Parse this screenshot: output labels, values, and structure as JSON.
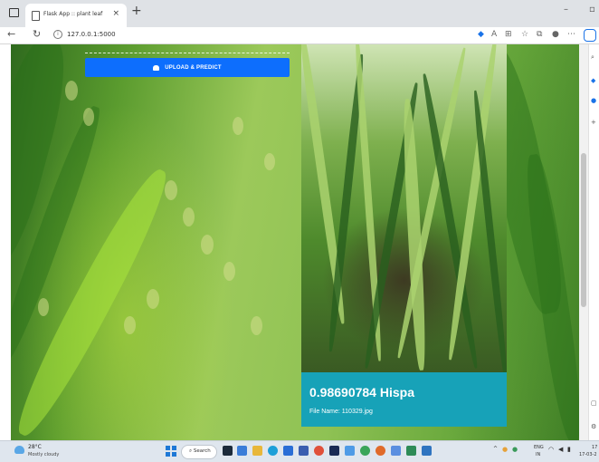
{
  "browser": {
    "tab_title": "Flask App :: plant leaf",
    "tab_close": "×",
    "new_tab": "+",
    "minimize": "–",
    "url": "127.0.0.1:5000"
  },
  "page": {
    "upload_button_label": "UPLOAD & PREDICT",
    "result_text": "0.98690784 Hispa",
    "file_name_text": "File Name: 110329.jpg"
  },
  "taskbar": {
    "temperature": "28°C",
    "weather": "Mostly cloudy",
    "search_label": "Search",
    "lang_top": "ENG",
    "lang_bottom": "IN",
    "time": "17",
    "date": "17-03-2"
  },
  "colors": {
    "accent_button": "#0d6efd",
    "result_card": "#17a2b8"
  }
}
